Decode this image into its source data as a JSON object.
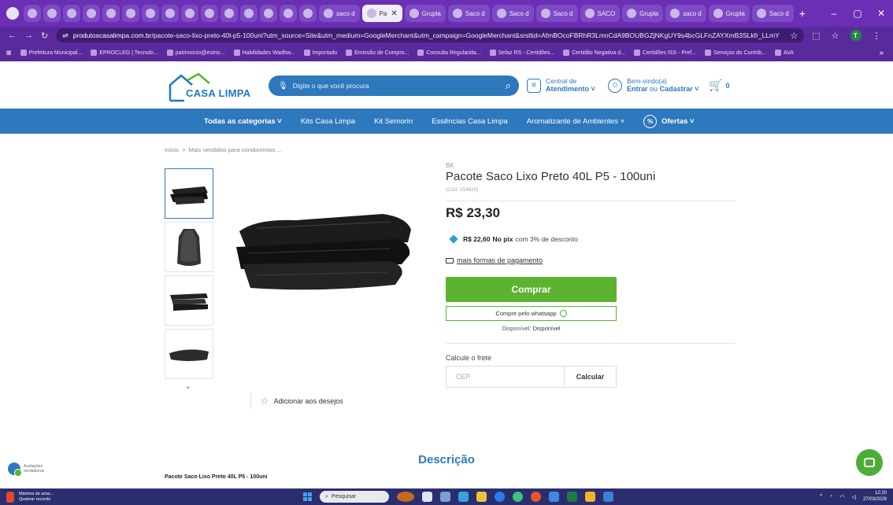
{
  "browser": {
    "tabs": [
      {
        "label": ""
      },
      {
        "label": ""
      },
      {
        "label": ""
      },
      {
        "label": ""
      },
      {
        "label": ""
      },
      {
        "label": ""
      },
      {
        "label": ""
      },
      {
        "label": ""
      },
      {
        "label": ""
      },
      {
        "label": ""
      },
      {
        "label": ""
      },
      {
        "label": ""
      },
      {
        "label": ""
      },
      {
        "label": ""
      },
      {
        "label": ""
      },
      {
        "label": "saco d"
      },
      {
        "label": "Pa"
      },
      {
        "label": "Grupla"
      },
      {
        "label": "Saco d"
      },
      {
        "label": "Saco d"
      },
      {
        "label": "Saco d"
      },
      {
        "label": "SACO"
      },
      {
        "label": "Grupla"
      },
      {
        "label": "saco d"
      },
      {
        "label": "Grupla"
      },
      {
        "label": "Saco d"
      }
    ],
    "url_domain": "produtoscasalimpa.com.br",
    "url_path": "/pacote-saco-lixo-preto-40l-p5-100uni?utm_source=Site&utm_medium=GoogleMerchant&utm_campaign=GoogleMerchant&srsltid=AfmBOcoFBRhR3LmnCdA9BOUBGZjNKgUY9s4bcGLFnZAYXmB3SLkfr_LLmY",
    "profile_initial": "T",
    "bookmarks": [
      "Prefeitura Municipal...",
      "EPROCLEG | Tecnolo...",
      "patrimonio@estrio...",
      "Habilidades Wadhw...",
      "Importado",
      "Emissão de Compro...",
      "Consulta Regularida...",
      "Sefaz RS - Certidões...",
      "Certidão Negativa d...",
      "Certidões ISS - Pref...",
      "Serviços do Contrib...",
      "AVA"
    ]
  },
  "header": {
    "logo_text": "CASA LIMPA",
    "search_placeholder": "Digite o que você procura",
    "support_line1": "Central de",
    "support_line2": "Atendimento",
    "account_line1": "Bem-vindo(a)",
    "account_login": "Entrar",
    "account_or": "ou",
    "account_register": "Cadastrar",
    "cart_count": "0"
  },
  "nav": {
    "items": [
      "Todas as categorias",
      "Kits Casa Limpa",
      "Kit Semorin",
      "Essências Casa Limpa",
      "Aromatizante de Ambientes"
    ],
    "offers": "Ofertas"
  },
  "breadcrumb": {
    "home": "Início",
    "separator": ">",
    "current": "Mais vendidos para condomínios ..."
  },
  "product": {
    "brand": "BK",
    "title": "Pacote Saco Lixo Preto 40L P5 - 100uni",
    "code": "(Cód. 154918)",
    "price": "R$ 23,30",
    "pix_price": "R$ 22,60",
    "pix_label": "No pix",
    "pix_discount": "com 3% de desconto",
    "payment_link": "mais formas de pagamento",
    "buy_button": "Comprar",
    "whatsapp_button": "Compre pelo whatsapp",
    "availability_label": "Disponível:",
    "availability_value": "Disponível",
    "shipping_title": "Calcule o frete",
    "cep_placeholder": "CEP",
    "calc_button": "Calcular",
    "wishlist": "Adicionar aos desejos"
  },
  "description": {
    "title": "Descrição",
    "subtitle": "Pacote Saco Lixo Preto 40L P5 - 100uni"
  },
  "reviews_badge": {
    "line1": "Avaliações",
    "line2": "verdadeiras"
  },
  "taskbar": {
    "weather_line1": "Máxima de ama...",
    "weather_line2": "Quebrar recorde",
    "search_placeholder": "Pesquisar",
    "time": "12:20",
    "date": "27/03/2026"
  },
  "colors": {
    "brand_blue": "#2e78bd",
    "buy_green": "#5cb32f",
    "browser_purple": "#6a2fb4"
  }
}
